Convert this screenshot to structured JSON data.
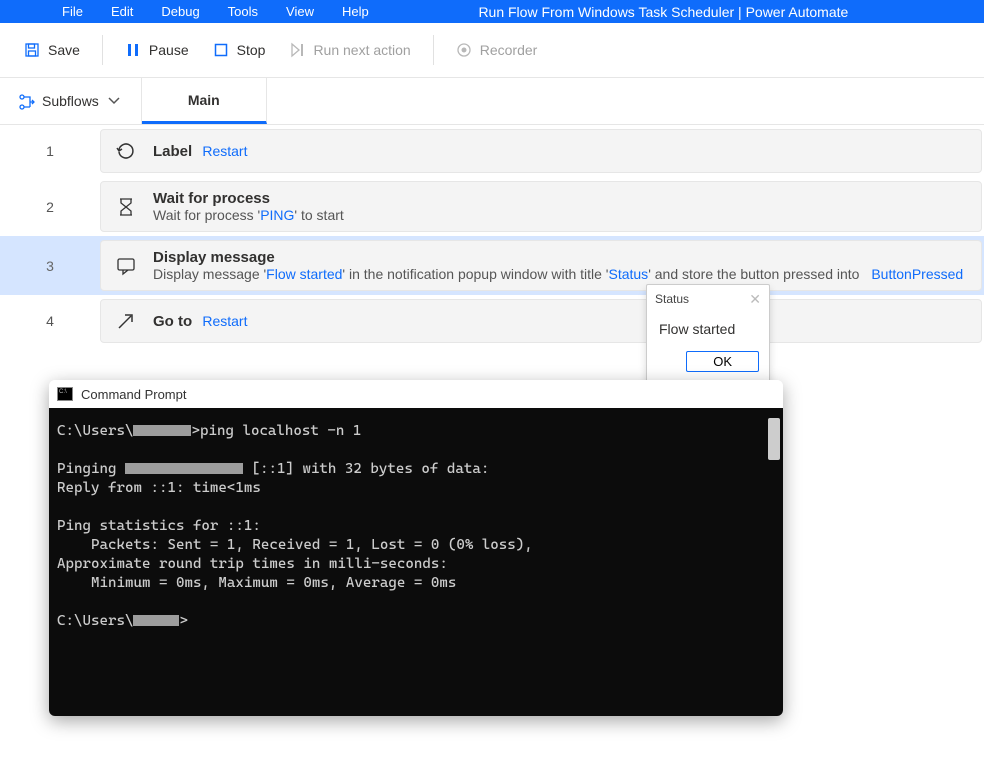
{
  "menubar": {
    "items": [
      "File",
      "Edit",
      "Debug",
      "Tools",
      "View",
      "Help"
    ],
    "title": "Run Flow From Windows Task Scheduler | Power Automate"
  },
  "toolbar": {
    "save": "Save",
    "pause": "Pause",
    "stop": "Stop",
    "run_next": "Run next action",
    "recorder": "Recorder"
  },
  "subflows": {
    "label": "Subflows"
  },
  "tabs": [
    {
      "label": "Main",
      "active": true
    }
  ],
  "actions": [
    {
      "line": 1,
      "title": "Label",
      "title_link": "Restart"
    },
    {
      "line": 2,
      "title": "Wait for process",
      "desc_pre": "Wait for process '",
      "lit1": "PING",
      "desc_post": "' to start"
    },
    {
      "line": 3,
      "selected": true,
      "title": "Display message",
      "desc_pre": "Display message '",
      "lit1": "Flow started",
      "desc_mid1": "' in the notification popup window with title '",
      "lit2": "Status",
      "desc_mid2": "' and store the button pressed into ",
      "var1": "ButtonPressed"
    },
    {
      "line": 4,
      "title": "Go to",
      "title_link": "Restart"
    }
  ],
  "dialog": {
    "title": "Status",
    "message": "Flow started",
    "ok": "OK"
  },
  "cmd": {
    "title": "Command Prompt",
    "l1a": "C:\\Users\\",
    "l1b": ">ping localhost -n 1",
    "l3a": "Pinging ",
    "l3b": " [::1] with 32 bytes of data:",
    "l4": "Reply from ::1: time<1ms",
    "l6": "Ping statistics for ::1:",
    "l7": "    Packets: Sent = 1, Received = 1, Lost = 0 (0% loss),",
    "l8": "Approximate round trip times in milli-seconds:",
    "l9": "    Minimum = 0ms, Maximum = 0ms, Average = 0ms",
    "l11a": "C:\\Users\\",
    "l11b": ">"
  }
}
